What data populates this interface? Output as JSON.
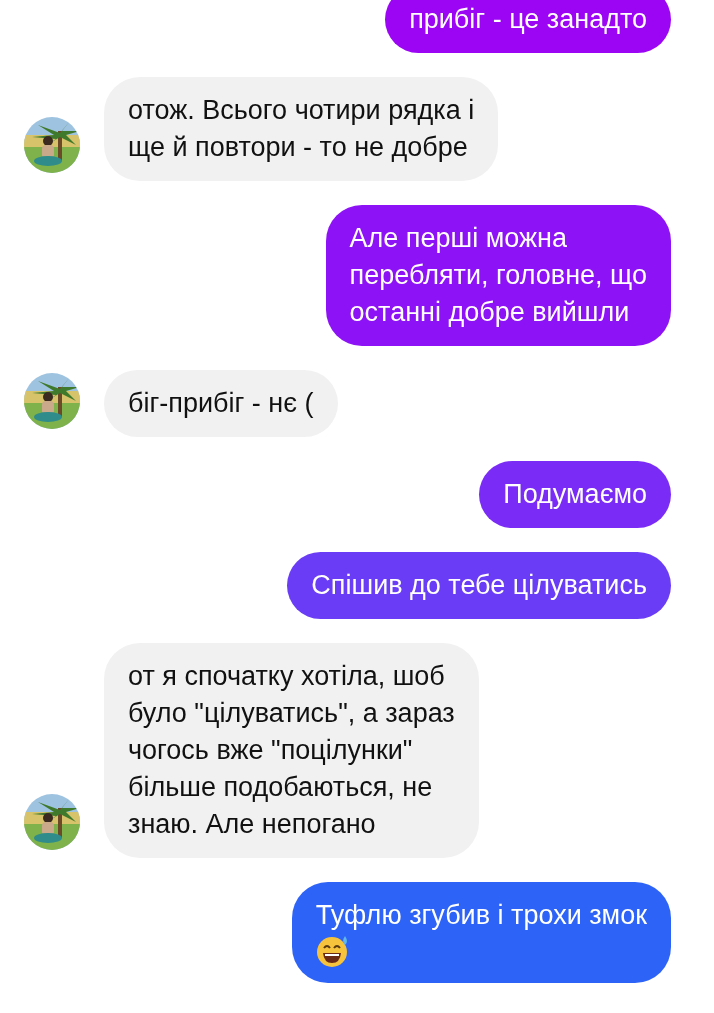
{
  "messages": [
    {
      "kind": "outgoing",
      "text": "прибіг - це занадто",
      "color": "#9b05f4"
    },
    {
      "kind": "incoming",
      "text": "отож. Всього чотири рядка і\nще й повтори - то не добре"
    },
    {
      "kind": "outgoing",
      "text": "Але перші можна\nперебляти, головне, що\nостанні добре вийшли",
      "color": "#8d12f5"
    },
    {
      "kind": "incoming",
      "text": "біг-прибіг - нє ("
    },
    {
      "kind": "outgoing",
      "text": "Подумаємо",
      "color": "#7a2bf6"
    },
    {
      "kind": "outgoing",
      "text": "Спішив до тебе цілуватись",
      "color": "#6a3cf6"
    },
    {
      "kind": "incoming",
      "text": "от я спочатку хотіла, шоб\nбуло \"цілуватись\", а зараз\nчогось вже \"поцілунки\"\nбільше подобаються, не\nзнаю. Але непогано"
    },
    {
      "kind": "outgoing",
      "text": "Туфлю згубив і трохи змок",
      "color": "#2d63f6",
      "emoji_after_text": true
    }
  ]
}
